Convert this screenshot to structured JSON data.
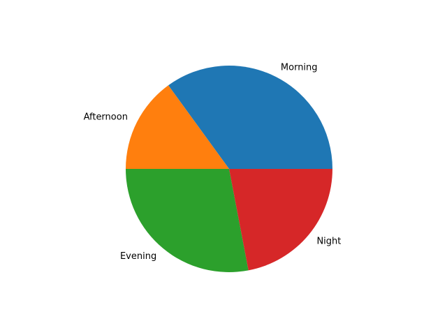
{
  "chart_data": {
    "type": "pie",
    "title": "",
    "labels": [
      "Morning",
      "Afternoon",
      "Evening",
      "Night"
    ],
    "values": [
      35,
      15,
      28,
      22
    ],
    "colors": [
      "#1f77b4",
      "#ff7f0e",
      "#2ca02c",
      "#d62728"
    ],
    "start_angle": 0,
    "direction": "counterclockwise",
    "legend": "none"
  }
}
